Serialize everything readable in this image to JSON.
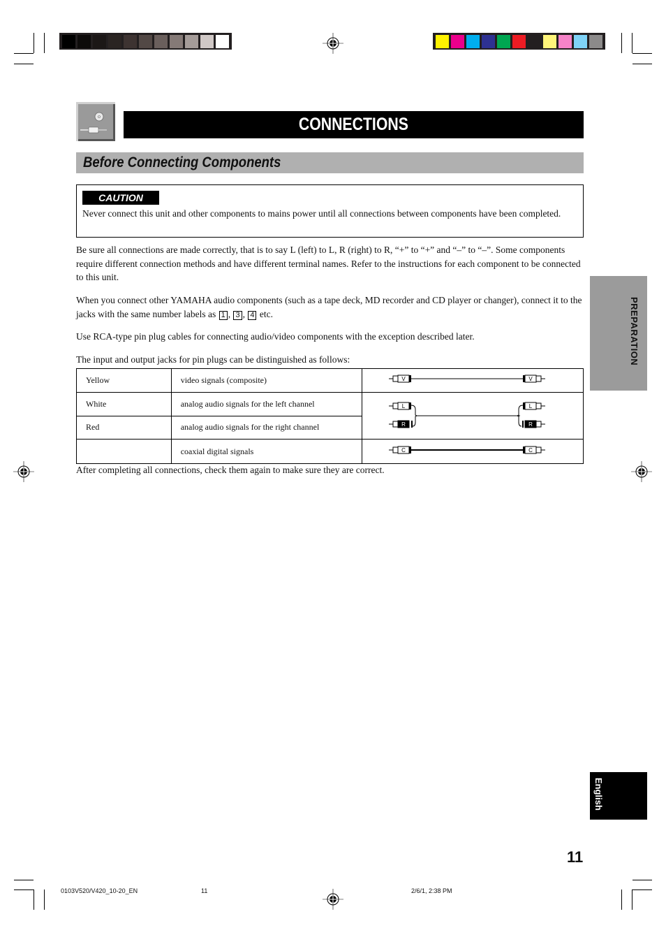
{
  "print_marks": {
    "gray_swatches": [
      "#000000",
      "#0d0b0a",
      "#1b1716",
      "#2a2422",
      "#3d3331",
      "#524845",
      "#6a5f5c",
      "#857a77",
      "#a59c99",
      "#d0c8c6",
      "#ffffff"
    ],
    "color_swatches": [
      "#fff200",
      "#ec008c",
      "#00aeef",
      "#2e3192",
      "#00a651",
      "#ed1c24",
      "#231f20",
      "#fff57a",
      "#f583c8",
      "#7fd3f7",
      "#8c8a8a"
    ]
  },
  "header": {
    "icon": "connection-cable-icon",
    "title": "CONNECTIONS",
    "section_title": "Before Connecting Components"
  },
  "caution": {
    "label": "CAUTION",
    "text": "Never connect this unit and other components to mains power until all connections between components have been completed."
  },
  "paragraphs": {
    "p1": "Be sure all connections are made correctly, that is to say L (left) to L, R (right) to R, “+” to “+” and “–” to “–”. Some components require different connection methods and have different terminal names. Refer to the instructions for each component to be connected to this unit.",
    "p2_before": "When you connect other YAMAHA audio components (such as a tape deck, MD recorder and CD player or changer), connect it to the jacks with the same number labels as",
    "p2_labels": [
      "1",
      "3",
      "4"
    ],
    "p2_after": "etc.",
    "p3": "Use RCA-type pin plug cables for connecting audio/video components with the exception described later.",
    "p4": "The input and output jacks for pin plugs can be distinguished as follows:",
    "p5": "After completing all connections, check them again to make sure they are correct."
  },
  "jack_table": {
    "rows": [
      {
        "color": "Yellow",
        "signal": "video signals (composite)",
        "plug_label": "V"
      },
      {
        "color": "White",
        "signal": "analog audio signals for the left channel",
        "plug_label": "L"
      },
      {
        "color": "Red",
        "signal": "analog audio signals for the right channel",
        "plug_label": "R"
      },
      {
        "color": "",
        "signal": "coaxial digital signals",
        "plug_label": "C"
      }
    ]
  },
  "side_tabs": {
    "section": "PREPARATION",
    "language": "English"
  },
  "page_number": "11",
  "footer": {
    "file": "0103V520/V420_10-20_EN",
    "page": "11",
    "date": "2/6/1, 2:38 PM"
  }
}
